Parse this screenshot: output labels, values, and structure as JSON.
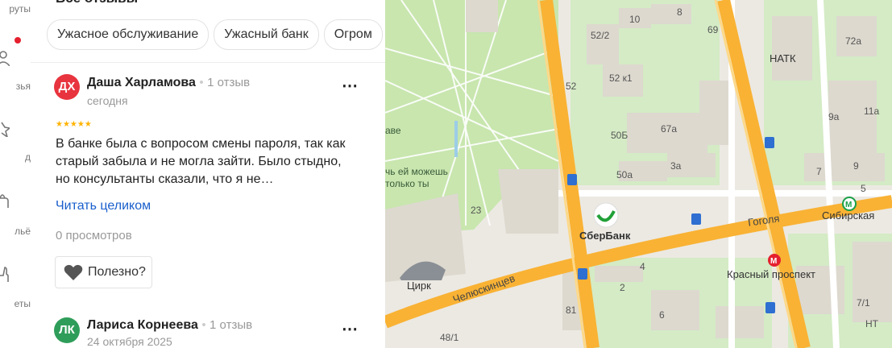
{
  "rail": {
    "items": [
      {
        "label": "руты",
        "icon": "route-icon"
      },
      {
        "label": "зья",
        "icon": "friends-icon"
      },
      {
        "label": "д",
        "icon": "star-icon"
      },
      {
        "label": "льё",
        "icon": "bag-icon"
      },
      {
        "label": "еты",
        "icon": "thumb-icon"
      }
    ],
    "has_notification": true
  },
  "reviews": {
    "section_title": "Все отзывы",
    "chips": [
      "Ужасное обслуживание",
      "Ужасный банк",
      "Огром"
    ],
    "items": [
      {
        "initials": "ДХ",
        "avatar_color": "#e8343e",
        "author": "Даша Харламова",
        "reviews_count": "1 отзыв",
        "date": "сегодня",
        "rating": 5,
        "stars": "★★★★★",
        "text": "В банке была с вопросом смены пароля, так как старый забыла и не могла зайти. Было стыдно, но консультанты сказали, что я не…",
        "read_more": "Читать целиком",
        "views": "0 просмотров",
        "helpful_label": "Полезно?"
      },
      {
        "initials": "ЛК",
        "avatar_color": "#2f9d5a",
        "author": "Лариса Корнеева",
        "reviews_count": "1 отзыв",
        "date": "24 октября 2025"
      }
    ],
    "separator": "•",
    "more_icon": "⋯"
  },
  "map": {
    "places": {
      "sberbank": "СберБанк",
      "circus": "Цирк",
      "natk": "НАТК",
      "metro_siberian": "Сибирская",
      "metro_red": "Красный проспект"
    },
    "streets": {
      "gogolya": "Гоголя",
      "chelyuskintsev": "Челюскинцев"
    },
    "park_text": [
      "аве",
      "чь ей можешь",
      "только ты"
    ],
    "buildings": [
      "10",
      "8",
      "52/2",
      "52",
      "52 к1",
      "50Б",
      "67а",
      "50а",
      "3а",
      "69",
      "72а",
      "11а",
      "9а",
      "7",
      "9",
      "5",
      "23",
      "4",
      "2",
      "81",
      "6",
      "48/1",
      "7/1",
      "НТ"
    ],
    "colors": {
      "major_road": "#f9b234",
      "park": "#c8e6ae",
      "building": "#ddd9cf",
      "metro": "#1aa048",
      "metro_red": "#e5202e"
    }
  }
}
